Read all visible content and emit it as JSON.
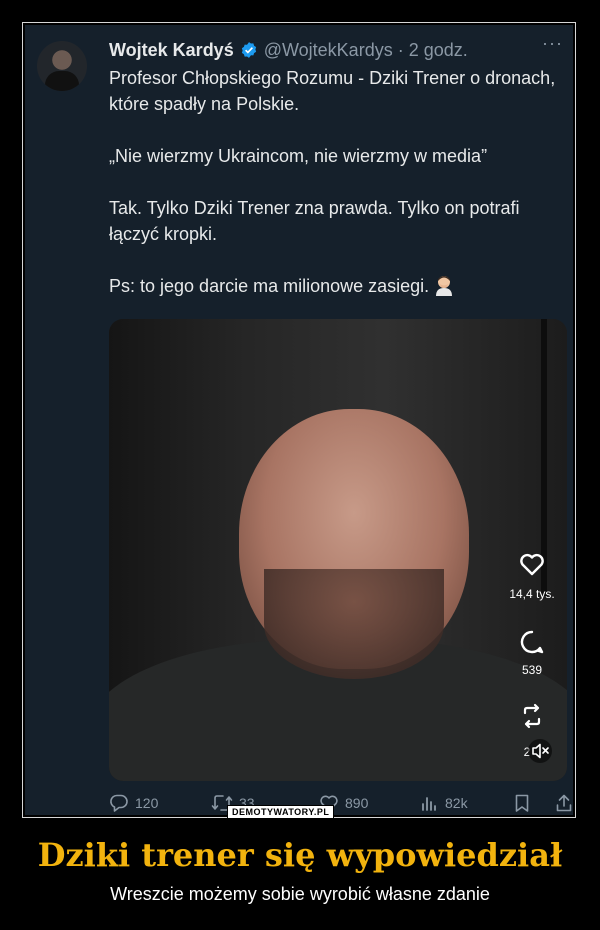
{
  "tweet": {
    "author_name": "Wojtek Kardyś",
    "handle_time": "@WojtekKardys · 2 godz.",
    "more_label": "···",
    "paragraphs": [
      "Profesor Chłopskiego Rozumu - Dziki Trener o dronach, które spadły na Polskie.",
      "„Nie wierzmy Ukraincom, nie wierzmy w media”",
      "Tak. Tylko Dziki Trener zna prawda. Tylko on potrafi łączyć kropki.",
      "Ps: to jego darcie ma milionowe zasiegi."
    ],
    "emoji": "man-facepalming-emoji",
    "video_overlay": {
      "likes": "14,4 tys.",
      "comments": "539",
      "reposts": "2"
    },
    "actions": {
      "replies": "120",
      "retweets": "33",
      "likes": "890",
      "views": "82k"
    }
  },
  "watermark": "DEMOTYWATORY.PL",
  "caption": {
    "title": "Dziki trener się wypowiedział",
    "subtitle": "Wreszcie możemy sobie wyrobić własne zdanie"
  },
  "colors": {
    "tweet_bg": "#15202b",
    "verified": "#1d9bf0",
    "caption_title": "#f2b30e"
  }
}
